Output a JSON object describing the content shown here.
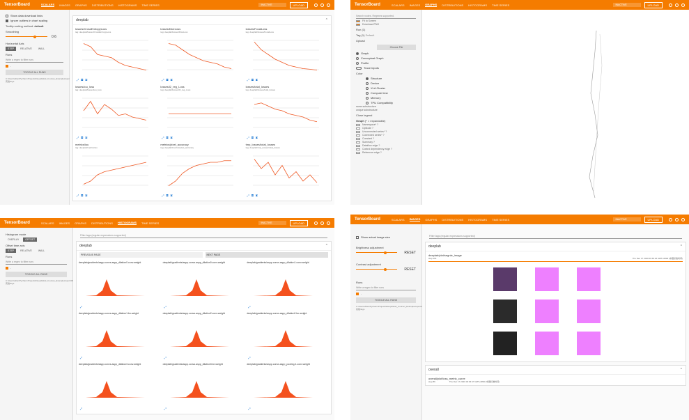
{
  "colors": {
    "accent": "#f57c00",
    "line": "#ef5722",
    "hist": "#f4511e",
    "magenta": "#ee80ff"
  },
  "app": {
    "brand": "TensorBoard",
    "status": "INACTIVE",
    "upload": "UPLOAD"
  },
  "tabs": [
    "SCALARS",
    "IMAGES",
    "GRAPHS",
    "DISTRIBUTIONS",
    "HISTOGRAMS",
    "TIME SERIES"
  ],
  "scalars": {
    "show_download": "Show data download links",
    "ignore_outliers": "Ignore outliers in chart scaling",
    "tooltip_label": "Tooltip sorting method:",
    "tooltip_value": "default",
    "smoothing_label": "Smoothing",
    "smoothing_value": "0.6",
    "haxis_label": "Horizontal Axis",
    "haxis_options": [
      "STEP",
      "RELATIVE",
      "WALL"
    ],
    "runs_label": "Runs",
    "runs_placeholder": "Write a regex to filter runs",
    "run_name": ".",
    "toggle_runs": "TOGGLE ALL RUNS",
    "log_path": "C:\\Users\\Allen\\PycharmProjects\\DeepRelief_Course\\_Examples\\sport\\00_实验\\logs",
    "group": "deeplab",
    "cards": [
      {
        "title": "losses/CrossEntropyLoss",
        "tag": "tag: deeplab/losses/CrossEntropyLoss"
      },
      {
        "title": "losses/DiceLoss",
        "tag": "tag: deeplab/losses/DiceLoss"
      },
      {
        "title": "losses/FocalLoss",
        "tag": "tag: deeplab/losses/FocalLoss"
      },
      {
        "title": "losses/iou_loss",
        "tag": "tag: deeplab/losses/iou_loss"
      },
      {
        "title": "losses/l2_reg_Loss",
        "tag": "tag: deeplab/losses/l2_reg_Loss"
      },
      {
        "title": "losses/total_losses",
        "tag": "tag: deeplab/losses/total_losses"
      },
      {
        "title": "metrics/iou",
        "tag": "tag: deeplab/metrics/iou"
      },
      {
        "title": "metrics/pixel_accuracy",
        "tag": "tag: deeplab/metrics/pixel_accuracy"
      },
      {
        "title": "tmp_losses/total_losses",
        "tag": "tag: deeplab/tmp_losses/total_losses"
      }
    ]
  },
  "graphs": {
    "search_placeholder": "Search nodes. Regexes supported.",
    "fit_screen": "Fit to Screen",
    "download_png": "Download PNG",
    "run_label": "Run",
    "run_count": "(1)",
    "tag_label": "Tag",
    "tag_count": "(1)",
    "tag_value": "Default",
    "upload_label": "Upload",
    "choose_file": "Choose File",
    "graph_types": [
      "Graph",
      "Conceptual Graph",
      "Profile"
    ],
    "trace_inputs": "Trace inputs",
    "color_label": "Color",
    "color_options": [
      "Structure",
      "Device",
      "XLA Cluster",
      "Compute time",
      "Memory",
      "TPU Compatibility"
    ],
    "colors_same": "same substructure",
    "colors_unique": "unique substructure",
    "close_legend": "Close legend",
    "graph_title": "Graph",
    "graph_expand": "(* = expandable)",
    "legend_items": [
      "Namespace* ?",
      "OpNode ?",
      "Unconnected series* ?",
      "Connected series* ?",
      "Constant ?",
      "Summary ?",
      "Dataflow edge ?",
      "Control dependency edge ?",
      "Reference edge ?"
    ]
  },
  "histograms": {
    "mode_label": "Histogram mode",
    "mode_options": [
      "OVERLAY",
      "OFFSET"
    ],
    "offset_label": "Offset time axis",
    "offset_options": [
      "STEP",
      "RELATIVE",
      "WALL"
    ],
    "filter_placeholder": "Filter tags (regular expressions supported)",
    "group": "deeplab",
    "prev": "PREVIOUS PAGE",
    "next": "NEXT PAGE",
    "cards": [
      "deeplab/gradients/aspp.convs.aspp_dilation0.conv.weight",
      "deeplab/gradients/aspp.convs.aspp_dilation0.conv.weight",
      "deeplab/gradients/aspp.convs.aspp_dilation1.conv.weight",
      "deeplab/gradients/aspp.convs.aspp_dilation1.bn.weight",
      "deeplab/gradients/aspp.convs.aspp_dilation2.conv.weight",
      "deeplab/gradients/aspp.convs.aspp_dilation2.bn.weight",
      "deeplab/gradients/aspp.convs.aspp_dilation3.conv.weight",
      "deeplab/gradients/aspp.convs.aspp_dilation3.bn.weight",
      "deeplab/gradients/aspp.convs.aspp_pooling.1.conv.weight"
    ]
  },
  "images": {
    "show_actual": "Show actual image size",
    "brightness": "Brightness adjustment",
    "contrast": "Contrast adjustment",
    "reset": "RESET",
    "filter_placeholder": "Filter tags (regular expressions supported)",
    "group": "deeplab",
    "card_title": "deeplab/plot/segnle_image",
    "step": "step 161",
    "timestamp": "Thu Dec 17 2020 00:46:22 GMT+0800 (中国标准时间)",
    "overall_group": "overall",
    "overall_title": "overall/plot/loss_metric_curve",
    "overall_step": "step 89",
    "overall_time": "Thu Dec 17 2020 00:45:47 GMT+0800 (中国标准时间)"
  }
}
